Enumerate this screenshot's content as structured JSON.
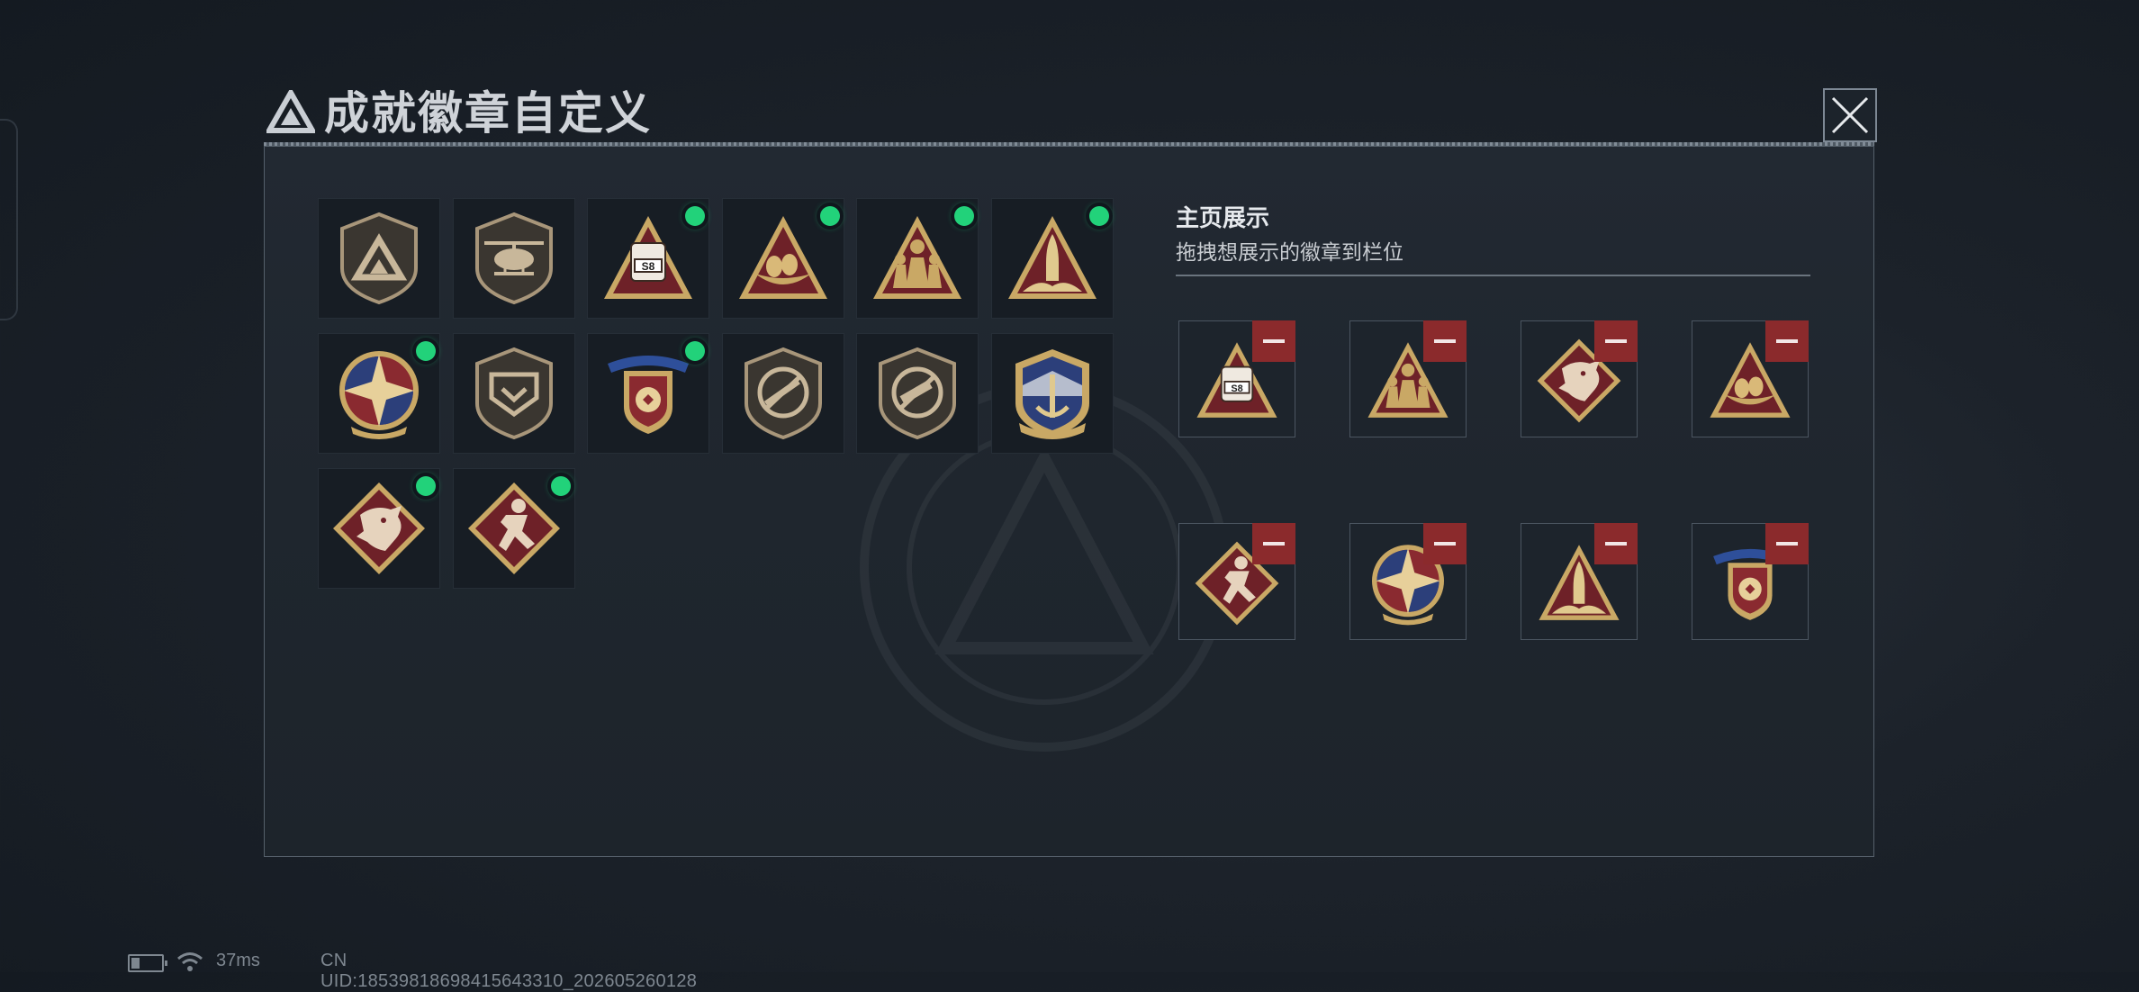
{
  "dialog": {
    "title": "成就徽章自定义",
    "close_icon": "close-icon",
    "logo_icon": "delta-logo-icon"
  },
  "badge_collection": [
    {
      "name": "delta-shield-badge",
      "new": false
    },
    {
      "name": "helicopter-shield-badge",
      "new": false
    },
    {
      "name": "s8-vehicle-triangle-badge",
      "new": true
    },
    {
      "name": "eggs-nest-triangle-badge",
      "new": true
    },
    {
      "name": "soldiers-triangle-badge",
      "new": true
    },
    {
      "name": "rocket-triangle-badge",
      "new": true
    },
    {
      "name": "star-compass-medal-badge",
      "new": true
    },
    {
      "name": "chevron-shield-badge",
      "new": false
    },
    {
      "name": "laurel-emblem-ribbon-badge",
      "new": true
    },
    {
      "name": "no-rifle-shield-badge",
      "new": false
    },
    {
      "name": "no-smg-shield-badge",
      "new": false
    },
    {
      "name": "anchor-wings-shield-badge",
      "new": false
    },
    {
      "name": "dragon-diamond-badge",
      "new": true
    },
    {
      "name": "runner-diamond-badge",
      "new": true
    }
  ],
  "homepage_display": {
    "title": "主页展示",
    "subtitle": "拖拽想展示的徽章到栏位",
    "slots": [
      {
        "name": "s8-vehicle-triangle-badge"
      },
      {
        "name": "soldiers-triangle-badge"
      },
      {
        "name": "dragon-diamond-badge"
      },
      {
        "name": "eggs-nest-triangle-badge"
      },
      {
        "name": "runner-diamond-badge"
      },
      {
        "name": "star-compass-medal-badge"
      },
      {
        "name": "rocket-triangle-badge"
      },
      {
        "name": "laurel-emblem-ribbon-badge"
      }
    ]
  },
  "badge_texts": {
    "s8_plate": "S8"
  },
  "status_bar": {
    "ping": "37ms",
    "uid": "CN UID:18539818698415643310_202605260128"
  },
  "colors": {
    "gold": "#c9a865",
    "crimson": "#7a2228",
    "new_dot": "#22d27a",
    "remove": "#8b2a2c"
  }
}
